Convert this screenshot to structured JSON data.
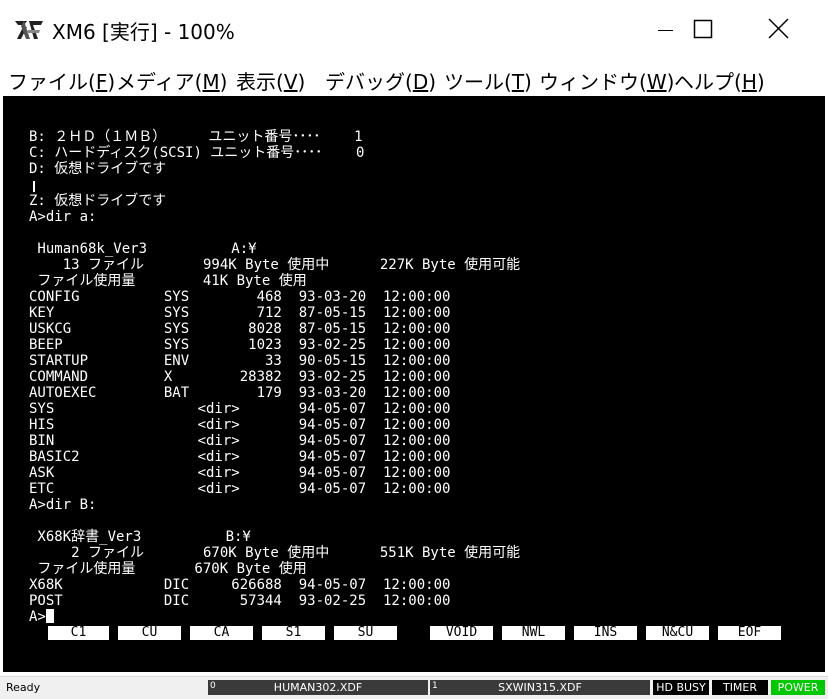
{
  "window": {
    "title": "XM6 [実行] - 100%",
    "icon": "xm6-logo-icon",
    "controls": {
      "minimize": "minimize-icon",
      "maximize": "maximize-icon",
      "close": "close-icon"
    }
  },
  "menu": [
    {
      "label": "ファイル(",
      "key": "F",
      "tail": ")"
    },
    {
      "label": "メディア(",
      "key": "M",
      "tail": ")"
    },
    {
      "label": "表示(",
      "key": "V",
      "tail": ")"
    },
    {
      "label": "デバッグ(",
      "key": "D",
      "tail": ")"
    },
    {
      "label": "ツール(",
      "key": "T",
      "tail": ")"
    },
    {
      "label": "ウィンドウ(",
      "key": "W",
      "tail": ")"
    },
    {
      "label": "ヘルプ(",
      "key": "H",
      "tail": ")"
    }
  ],
  "terminal": {
    "lines": [
      "B: ２ＨＤ（１ＭＢ）     ユニット番号････    1",
      "C: ハードディスク(SCSI) ユニット番号････    0",
      "D: 仮想ドライブです",
      "",
      "Z: 仮想ドライブです",
      "A>dir a:",
      "",
      " Human68k_Ver3          A:¥",
      "    13 ファイル       994K Byte 使用中      227K Byte 使用可能",
      " ファイル使用量        41K Byte 使用",
      "CONFIG          SYS        468  93-03-20  12:00:00",
      "KEY             SYS        712  87-05-15  12:00:00",
      "USKCG           SYS       8028  87-05-15  12:00:00",
      "BEEP            SYS       1023  93-02-25  12:00:00",
      "STARTUP         ENV         33  90-05-15  12:00:00",
      "COMMAND         X        28382  93-02-25  12:00:00",
      "AUTOEXEC        BAT        179  93-03-20  12:00:00",
      "SYS                 <dir>       94-05-07  12:00:00",
      "HIS                 <dir>       94-05-07  12:00:00",
      "BIN                 <dir>       94-05-07  12:00:00",
      "BASIC2              <dir>       94-05-07  12:00:00",
      "ASK                 <dir>       94-05-07  12:00:00",
      "ETC                 <dir>       94-05-07  12:00:00",
      "A>dir B:",
      "",
      " X68K辞書_Ver3          B:¥",
      "     2 ファイル       670K Byte 使用中      551K Byte 使用可能",
      " ファイル使用量       670K Byte 使用",
      "X68K            DIC     626688  94-05-07  12:00:00",
      "POST            DIC      57344  93-02-25  12:00:00",
      "A>"
    ]
  },
  "function_keys": [
    "C1",
    "CU",
    "CA",
    "S1",
    "SU",
    "VOID",
    "NWL",
    "INS",
    "N&CU",
    "EOF"
  ],
  "status": {
    "ready": "Ready",
    "drive0": {
      "num": "0",
      "file": "HUMAN302.XDF"
    },
    "drive1": {
      "num": "1",
      "file": "SXWIN315.XDF"
    },
    "hd_busy": "HD BUSY",
    "timer": "TIMER",
    "power": "POWER",
    "power_color": "#00c800"
  }
}
